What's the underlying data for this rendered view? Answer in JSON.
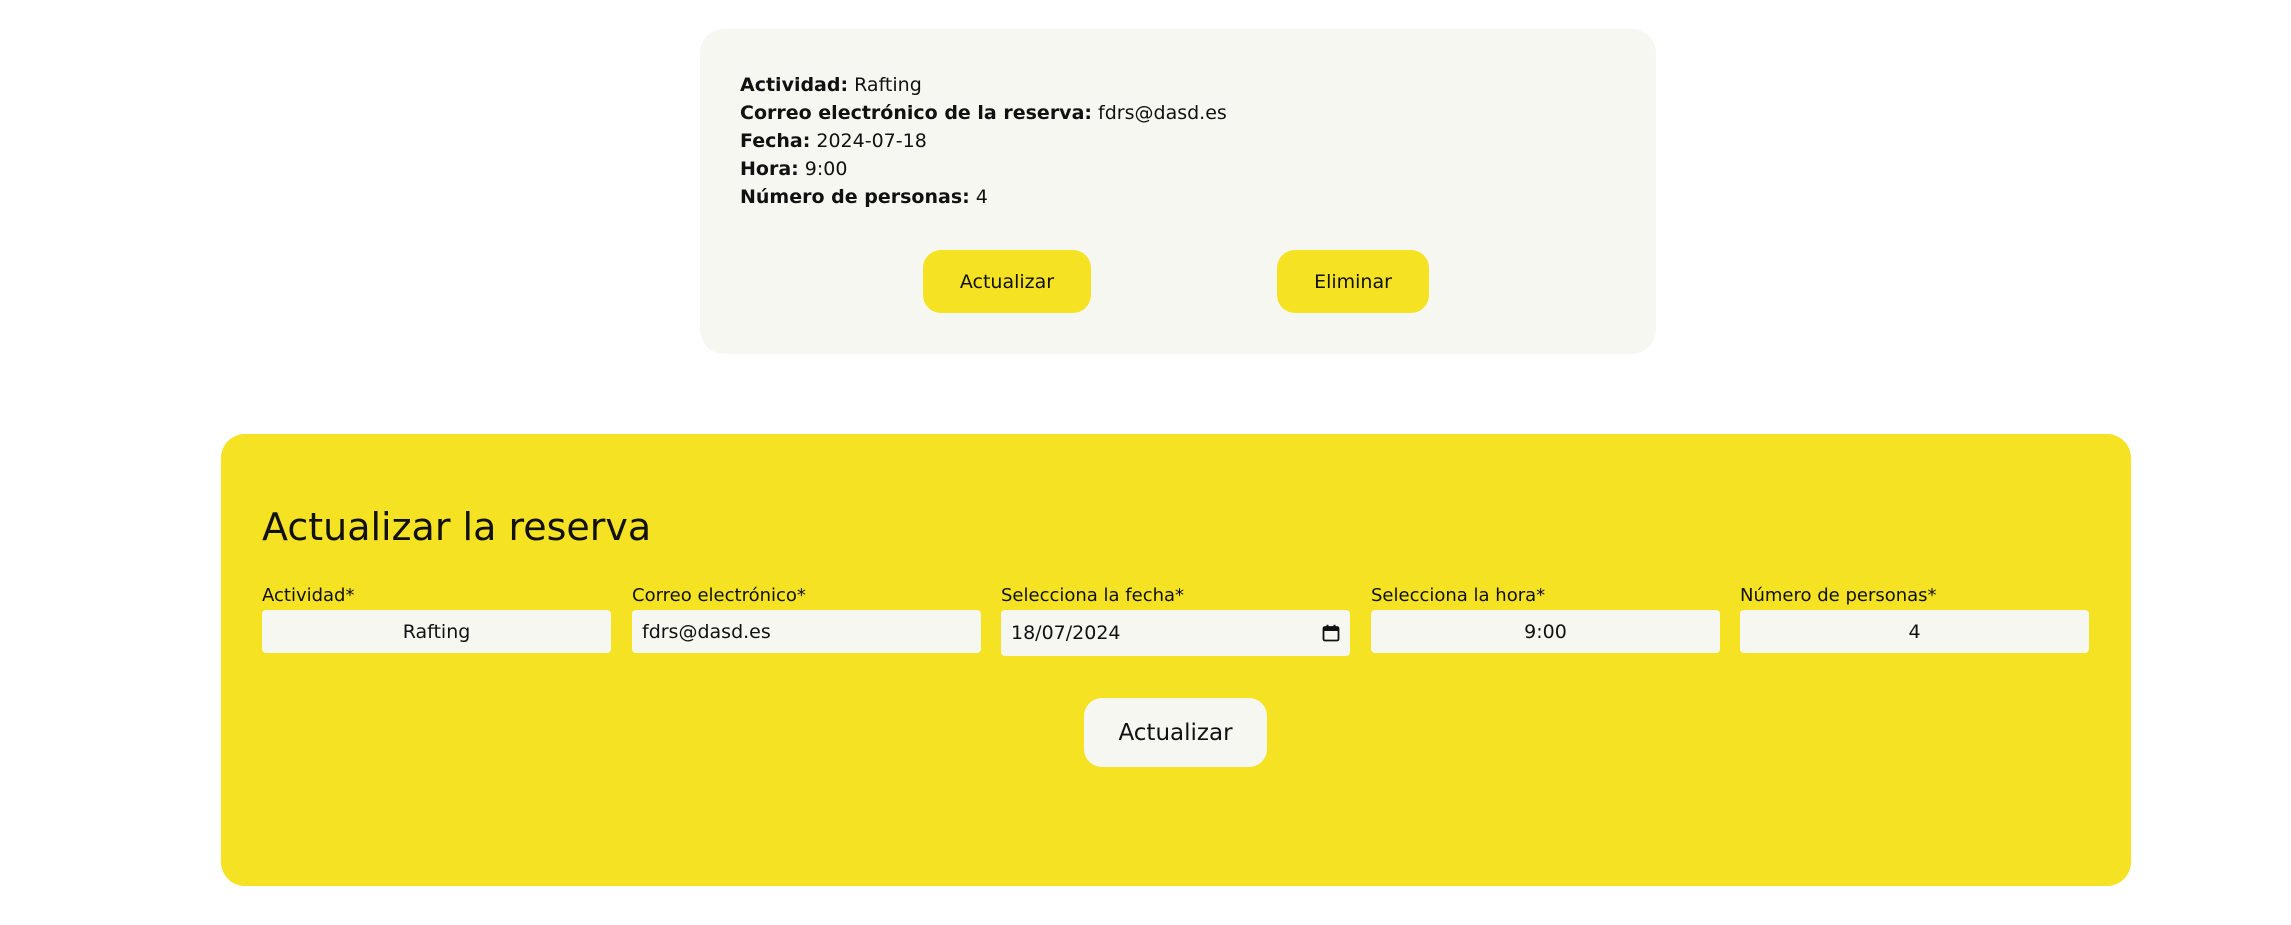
{
  "summary": {
    "activity_label": "Actividad:",
    "activity_value": "Rafting",
    "email_label": "Correo electrónico de la reserva:",
    "email_value": "fdrs@dasd.es",
    "date_label": "Fecha:",
    "date_value": "2024-07-18",
    "time_label": "Hora:",
    "time_value": "9:00",
    "people_label": "Número de personas:",
    "people_value": "4",
    "update_button": "Actualizar",
    "delete_button": "Eliminar"
  },
  "form": {
    "title": "Actualizar la reserva",
    "fields": [
      {
        "label": "Actividad*",
        "value": "Rafting"
      },
      {
        "label": "Correo electrónico*",
        "value": "fdrs@dasd.es"
      },
      {
        "label": "Selecciona la fecha*",
        "value": "18/07/2024",
        "icon": "calendar-icon"
      },
      {
        "label": "Selecciona la hora*",
        "value": "9:00"
      },
      {
        "label": "Número de personas*",
        "value": "4"
      }
    ],
    "submit_button": "Actualizar"
  },
  "colors": {
    "accent_yellow": "#f4e223",
    "card_background": "#f7f7f2",
    "page_background": "#ffffff",
    "text": "#111111"
  }
}
